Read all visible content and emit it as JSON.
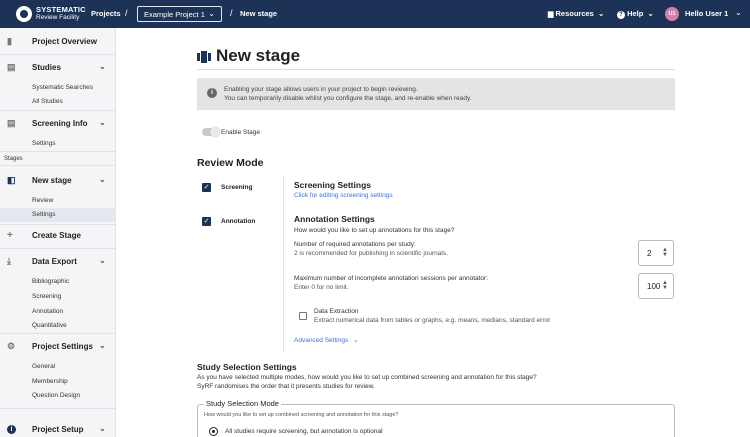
{
  "topbar": {
    "logo_line1": "SYSTEMATIC",
    "logo_line2": "Review Facility",
    "projects_link": "Projects",
    "sep": "/",
    "project_select": "Example Project 1",
    "current_stage": "New stage",
    "resources": "Resources",
    "help": "Help",
    "avatar_initials": "U1",
    "user": "Hello User 1"
  },
  "sidebar": {
    "project_overview": "Project Overview",
    "studies": "Studies",
    "systematic_searches": "Systematic Searches",
    "all_studies": "All Studies",
    "screening_info": "Screening Info",
    "settings": "Settings",
    "stages": "Stages",
    "new_stage": "New stage",
    "review": "Review",
    "stage_settings": "Settings",
    "create_stage": "Create Stage",
    "data_export": "Data Export",
    "bibliographic": "Bibliographic",
    "screening": "Screening",
    "annotation": "Annotation",
    "quantitative": "Quantitative",
    "project_settings": "Project Settings",
    "general": "General",
    "membership": "Membership",
    "question_design": "Question Design",
    "project_setup": "Project Setup"
  },
  "main": {
    "title": "New stage",
    "info_line1": "Enabling your stage allows users in your project to begin reviewing.",
    "info_line2": "You can temporarily disable whilst you configure the stage, and re-enable when ready.",
    "enable_stage": "Enable Stage",
    "review_mode": "Review Mode",
    "mode_screening": "Screening",
    "mode_annotation": "Annotation",
    "screening_settings": "Screening Settings",
    "screening_link": "Click for editing screening settings",
    "annotation_settings": "Annotation Settings",
    "annotation_question": "How would you like to set up annotations for this stage?",
    "required_label": "Number of required annotations per study:",
    "required_hint": "2 is recommended for publishing in scientific journals.",
    "required_value": "2",
    "incomplete_label": "Maximum number of incomplete annotation sessions per annotator:",
    "incomplete_hint": "Enter 0 for no limit.",
    "incomplete_value": "100",
    "data_extraction": "Data Extraction",
    "data_extraction_hint": "Extract numerical data from tables or graphs, e.g. means, medians, standard error",
    "advanced_settings": "Advanced Settings",
    "study_selection_settings": "Study Selection Settings",
    "study_selection_line1": "As you have selected multiple modes, how would you like to set up combined screening and annotation for this stage?",
    "study_selection_line2": "SyRF randomises the order that it presents studies for review.",
    "study_selection_mode": "Study Selection Mode",
    "mode_hint": "How would you like to set up combined screening and annotation for this stage?",
    "radio_option1": "All studies require screening, but annotation is optional"
  }
}
